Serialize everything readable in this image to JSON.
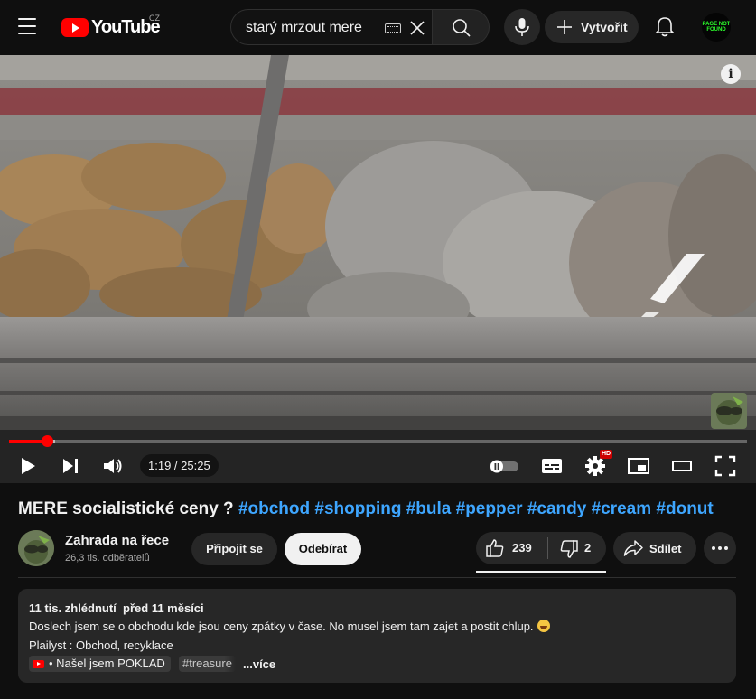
{
  "header": {
    "logo_text": "YouTube",
    "country_code": "CZ",
    "search_value": "starý mrzout mere",
    "create_label": "Vytvořit",
    "avatar_text": "PAGE NOT FOUND"
  },
  "player": {
    "time_display": "1:19 / 25:25",
    "played_fraction": 0.052,
    "buffered_fraction": 0.062,
    "info_label": "i",
    "settings_badge": "HD"
  },
  "video": {
    "title_text": "MERE socialistické ceny ? ",
    "hashtags": "#obchod #shopping #bula #pepper #candy #cream #donut"
  },
  "channel": {
    "name": "Zahrada na řece",
    "subscribers": "26,3 tis. odběratelů",
    "join_label": "Připojit se",
    "subscribe_label": "Odebírat"
  },
  "actions": {
    "like_count": "239",
    "dislike_count": "2",
    "share_label": "Sdílet"
  },
  "description": {
    "views": "11 tis. zhlédnutí",
    "date": "před 11 měsíci",
    "line1": "Doslech jsem se o obchodu kde jsou ceny zpátky v čase. No musel jsem tam zajet a postit chlup.",
    "line2": "Plailyst : Obchod, recyklace",
    "playlist_chip": "• Našel jsem POKLAD",
    "hashtag_chip": "#treasure",
    "more_label": "...více"
  },
  "colors": {
    "background": "#0f0f0f",
    "progress": "#ff0000",
    "hashtag": "#3ea6ff",
    "surface": "#272727"
  }
}
